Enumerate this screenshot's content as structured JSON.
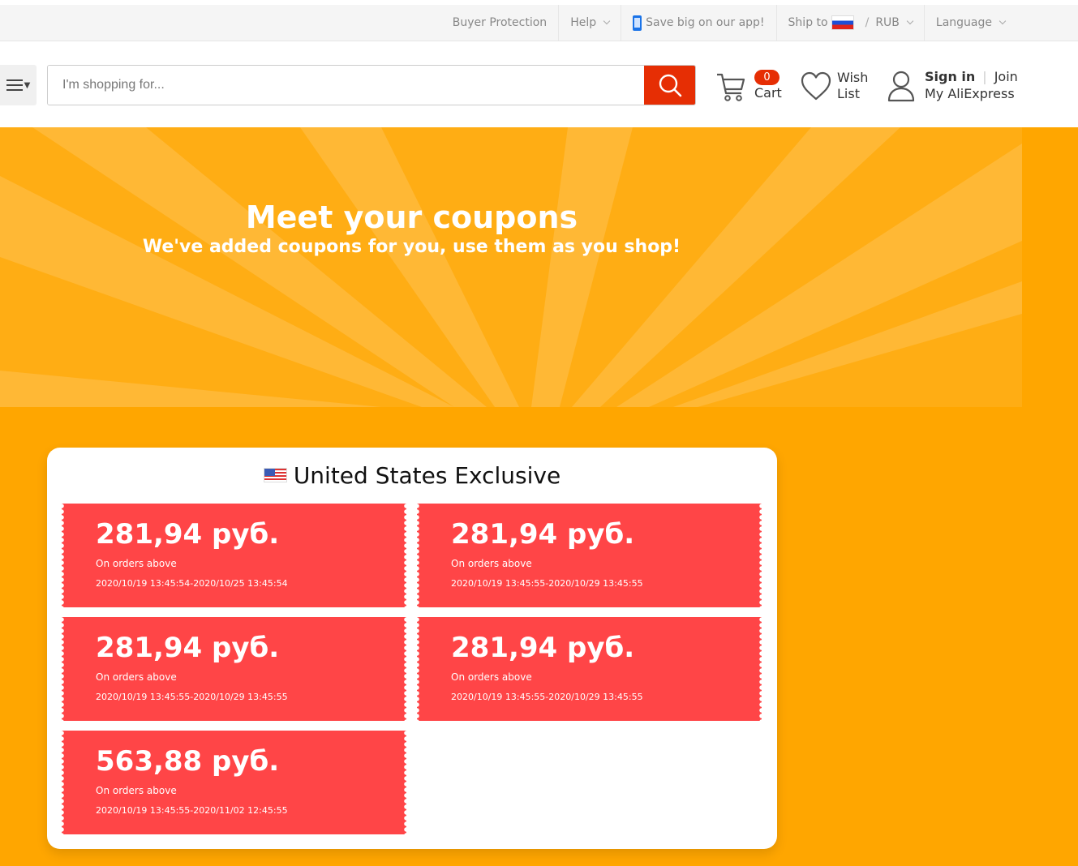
{
  "topbar": {
    "buyer_protection": "Buyer Protection",
    "help": "Help",
    "app_promo": "Save big on our app!",
    "ship_to": "Ship to",
    "separator": "/",
    "currency": "RUB",
    "language": "Language"
  },
  "header": {
    "search_placeholder": "I'm shopping for...",
    "cart_count": "0",
    "cart_label": "Cart",
    "wish_line1": "Wish",
    "wish_line2": "List",
    "sign_in": "Sign in",
    "join": "Join",
    "my_account": "My AliExpress"
  },
  "hero": {
    "title": "Meet your coupons",
    "subtitle": "We've added coupons for you, use them as you shop!"
  },
  "coupons_panel": {
    "title": "United States Exclusive",
    "coupons": [
      {
        "amount": "281,94 руб.",
        "condition": "On orders above",
        "dates": "2020/10/19 13:45:54-2020/10/25 13:45:54"
      },
      {
        "amount": "281,94 руб.",
        "condition": "On orders above",
        "dates": "2020/10/19 13:45:55-2020/10/29 13:45:55"
      },
      {
        "amount": "281,94 руб.",
        "condition": "On orders above",
        "dates": "2020/10/19 13:45:55-2020/10/29 13:45:55"
      },
      {
        "amount": "281,94 руб.",
        "condition": "On orders above",
        "dates": "2020/10/19 13:45:55-2020/10/29 13:45:55"
      },
      {
        "amount": "563,88 руб.",
        "condition": "On orders above",
        "dates": "2020/10/19 13:45:55-2020/11/02 12:45:55"
      }
    ]
  },
  "colors": {
    "background": "#ffa600",
    "coupon": "#ff4547",
    "search_button": "#e62e04",
    "badge": "#e62e04"
  },
  "icons": [
    "phone-icon",
    "chevron-down-icon",
    "russia-flag-icon",
    "menu-icon",
    "search-icon",
    "cart-icon",
    "heart-icon",
    "user-icon",
    "us-flag-icon"
  ]
}
